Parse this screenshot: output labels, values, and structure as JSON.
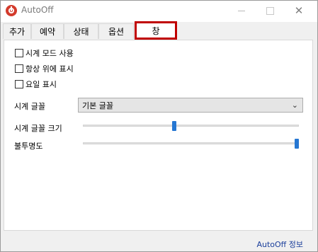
{
  "window": {
    "title": "AutoOff",
    "close_glyph": "✕"
  },
  "tabs": [
    {
      "label": "추가"
    },
    {
      "label": "예약"
    },
    {
      "label": "상태"
    },
    {
      "label": "옵션"
    },
    {
      "label": "창",
      "selected": true
    }
  ],
  "panel": {
    "checkboxes": [
      {
        "label": "시계 모드 사용",
        "checked": false
      },
      {
        "label": "항상 위에 표시",
        "checked": false
      },
      {
        "label": "요일 표시",
        "checked": false
      }
    ],
    "font_label": "시계 글꼴",
    "font_value": "기본 글꼴",
    "font_size_label": "시계 글꼴 크기",
    "font_size_level": 0.42,
    "opacity_label": "불투명도",
    "opacity_level": 1.0
  },
  "footer": {
    "about_link": "AutoOff 정보"
  },
  "colors": {
    "accent": "#2677d2",
    "tab_highlight": "#c00000",
    "link": "#1a3e9b"
  }
}
